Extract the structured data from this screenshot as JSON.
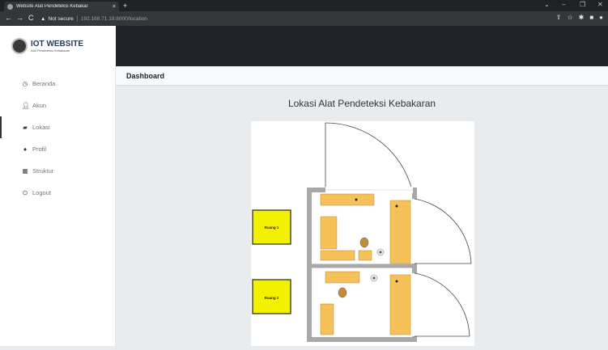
{
  "browser": {
    "tab_title": "Website Alat Pendeteksi Kebakar",
    "tab_close": "×",
    "new_tab": "+",
    "not_secure": "Not secure",
    "url": "192.168.71.18:8000/location"
  },
  "brand": {
    "title": "IOT WEBSITE",
    "subtitle": "Alat Pendeteksi Kebakaran"
  },
  "sidebar": {
    "items": [
      {
        "label": "Beranda",
        "icon": "clock-icon"
      },
      {
        "label": "Akun",
        "icon": "user-icon"
      },
      {
        "label": "Lokasi",
        "icon": "map-icon",
        "active": true
      },
      {
        "label": "Profil",
        "icon": "info-icon"
      },
      {
        "label": "Struktur",
        "icon": "table-icon"
      },
      {
        "label": "Logout",
        "icon": "power-icon"
      }
    ]
  },
  "header": {
    "title": "Dashboard"
  },
  "main": {
    "heading": "Lokasi Alat Pendeteksi Kebakaran",
    "map": {
      "room1": "Ruang 1",
      "room2": "Ruang 2"
    }
  },
  "colors": {
    "room_yellow": "#f2f200",
    "furniture": "#f5c158",
    "wall": "#a8a8a8",
    "topbar": "#212529"
  }
}
